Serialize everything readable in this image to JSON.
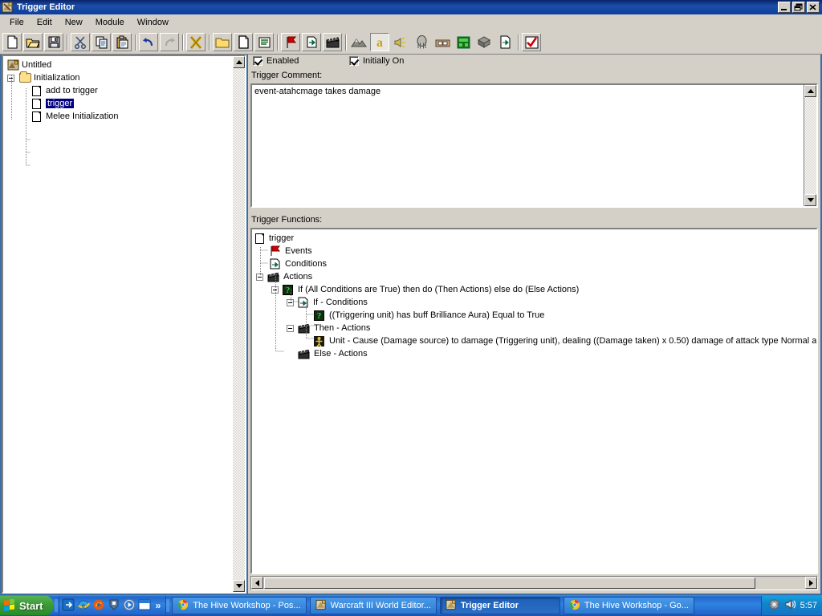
{
  "window": {
    "title": "Trigger Editor",
    "icon": "trigger-editor-icon",
    "buttons": {
      "minimize": "_",
      "restore": "❐",
      "close": "✕"
    }
  },
  "menu": {
    "items": [
      {
        "label": "File"
      },
      {
        "label": "Edit"
      },
      {
        "label": "New"
      },
      {
        "label": "Module"
      },
      {
        "label": "Window"
      }
    ]
  },
  "toolbar": {
    "groups": [
      {
        "buttons": [
          {
            "name": "new-file-icon",
            "title": "New"
          },
          {
            "name": "open-folder-icon",
            "title": "Open"
          },
          {
            "name": "save-disk-icon",
            "title": "Save"
          }
        ]
      },
      {
        "buttons": [
          {
            "name": "cut-scissors-icon",
            "title": "Cut"
          },
          {
            "name": "copy-icon",
            "title": "Copy"
          },
          {
            "name": "paste-clipboard-icon",
            "title": "Paste"
          }
        ]
      },
      {
        "buttons": [
          {
            "name": "undo-arrow-icon",
            "title": "Undo"
          },
          {
            "name": "redo-arrow-icon",
            "title": "Redo"
          }
        ]
      },
      {
        "buttons": [
          {
            "name": "close-x-icon",
            "title": "Close Map"
          }
        ]
      },
      {
        "buttons": [
          {
            "name": "new-category-folder-icon",
            "title": "New Category"
          },
          {
            "name": "new-trigger-page-icon",
            "title": "New Trigger"
          },
          {
            "name": "new-comment-icon",
            "title": "New Trigger Comment"
          }
        ]
      },
      {
        "buttons": [
          {
            "name": "new-event-flag-icon",
            "title": "New Event"
          },
          {
            "name": "new-condition-icon",
            "title": "New Condition"
          },
          {
            "name": "new-action-clapper-icon",
            "title": "New Action"
          }
        ]
      },
      {
        "buttons": [
          {
            "name": "terrain-editor-icon",
            "title": "Terrain Editor"
          },
          {
            "name": "trigger-editor-a-icon",
            "title": "Trigger Editor"
          },
          {
            "name": "sound-editor-icon",
            "title": "Sound Editor"
          },
          {
            "name": "object-editor-icon",
            "title": "Object Editor"
          },
          {
            "name": "campaign-editor-icon",
            "title": "Campaign Editor"
          },
          {
            "name": "ai-editor-icon",
            "title": "AI Editor"
          },
          {
            "name": "object-manager-icon",
            "title": "Object Manager"
          },
          {
            "name": "import-manager-icon",
            "title": "Import Manager"
          }
        ]
      },
      {
        "buttons": [
          {
            "name": "test-map-check-icon",
            "title": "Test Map"
          }
        ]
      }
    ]
  },
  "tree": {
    "name": "trigger-tree",
    "nodes": [
      {
        "label": "Untitled",
        "icon": "map-icon",
        "depth": 0,
        "expander": "none",
        "selected": false
      },
      {
        "label": "Initialization",
        "icon": "folder-icon",
        "depth": 1,
        "expander": "minus",
        "selected": false
      },
      {
        "label": "add to trigger",
        "icon": "trigger-page-icon",
        "depth": 2,
        "expander": "none",
        "selected": false
      },
      {
        "label": "trigger",
        "icon": "trigger-page-icon",
        "depth": 2,
        "expander": "none",
        "selected": true
      },
      {
        "label": "Melee Initialization",
        "icon": "trigger-page-icon",
        "depth": 2,
        "expander": "none",
        "selected": false
      }
    ]
  },
  "properties": {
    "enabled": {
      "label": "Enabled",
      "checked": true
    },
    "initially_on": {
      "label": "Initially On",
      "checked": true
    },
    "comment_label": "Trigger Comment:",
    "comment_value": "event-atahcmage takes damage"
  },
  "functions": {
    "label": "Trigger Functions:",
    "nodes": [
      {
        "label": "trigger",
        "icon": "trigger-page-icon",
        "depth": 0,
        "expander": "none"
      },
      {
        "label": "Events",
        "icon": "event-flag-icon",
        "depth": 1,
        "expander": "none"
      },
      {
        "label": "Conditions",
        "icon": "condition-icon",
        "depth": 1,
        "expander": "none"
      },
      {
        "label": "Actions",
        "icon": "action-clapper-icon",
        "depth": 1,
        "expander": "minus"
      },
      {
        "label": "If (All Conditions are True) then do (Then Actions) else do (Else Actions)",
        "icon": "if-then-else-icon",
        "depth": 2,
        "expander": "minus"
      },
      {
        "label": "If - Conditions",
        "icon": "condition-icon",
        "depth": 3,
        "expander": "minus"
      },
      {
        "label": "((Triggering unit) has buff Brilliance Aura) Equal to True",
        "icon": "if-then-else-icon",
        "depth": 4,
        "expander": "none"
      },
      {
        "label": "Then - Actions",
        "icon": "action-clapper-icon",
        "depth": 3,
        "expander": "minus"
      },
      {
        "label": "Unit - Cause (Damage source) to damage (Triggering unit), dealing ((Damage taken) x 0.50) damage of attack type Normal and damage type Normal",
        "icon": "unit-action-icon",
        "depth": 4,
        "expander": "none"
      },
      {
        "label": "Else - Actions",
        "icon": "action-clapper-icon",
        "depth": 3,
        "expander": "none"
      }
    ]
  },
  "scrollbars": {
    "comment_vertical": {
      "up": "▲",
      "down": "▼"
    },
    "functions_horizontal": {
      "left": "◄",
      "right": "►",
      "thumb_percent": 88
    }
  },
  "taskbar": {
    "start_label": "Start",
    "quick_launch": [
      {
        "name": "show-desktop-icon"
      },
      {
        "name": "internet-explorer-icon"
      },
      {
        "name": "firefox-icon"
      },
      {
        "name": "utorrent-icon"
      },
      {
        "name": "media-player-icon"
      },
      {
        "name": "window-icon"
      },
      {
        "name": "chevron-double-right-icon",
        "label": "»"
      }
    ],
    "tasks": [
      {
        "label": "The Hive Workshop - Pos...",
        "icon": "chrome-icon",
        "active": false
      },
      {
        "label": "Warcraft III World Editor...",
        "icon": "world-editor-icon",
        "active": false
      },
      {
        "label": "Trigger Editor",
        "icon": "trigger-editor-icon",
        "active": true
      },
      {
        "label": "The Hive Workshop - Go...",
        "icon": "chrome-icon",
        "active": false
      }
    ],
    "tray": {
      "icons": [
        {
          "name": "safely-remove-hardware-icon"
        },
        {
          "name": "volume-speaker-icon"
        }
      ],
      "clock": "5:57"
    }
  }
}
